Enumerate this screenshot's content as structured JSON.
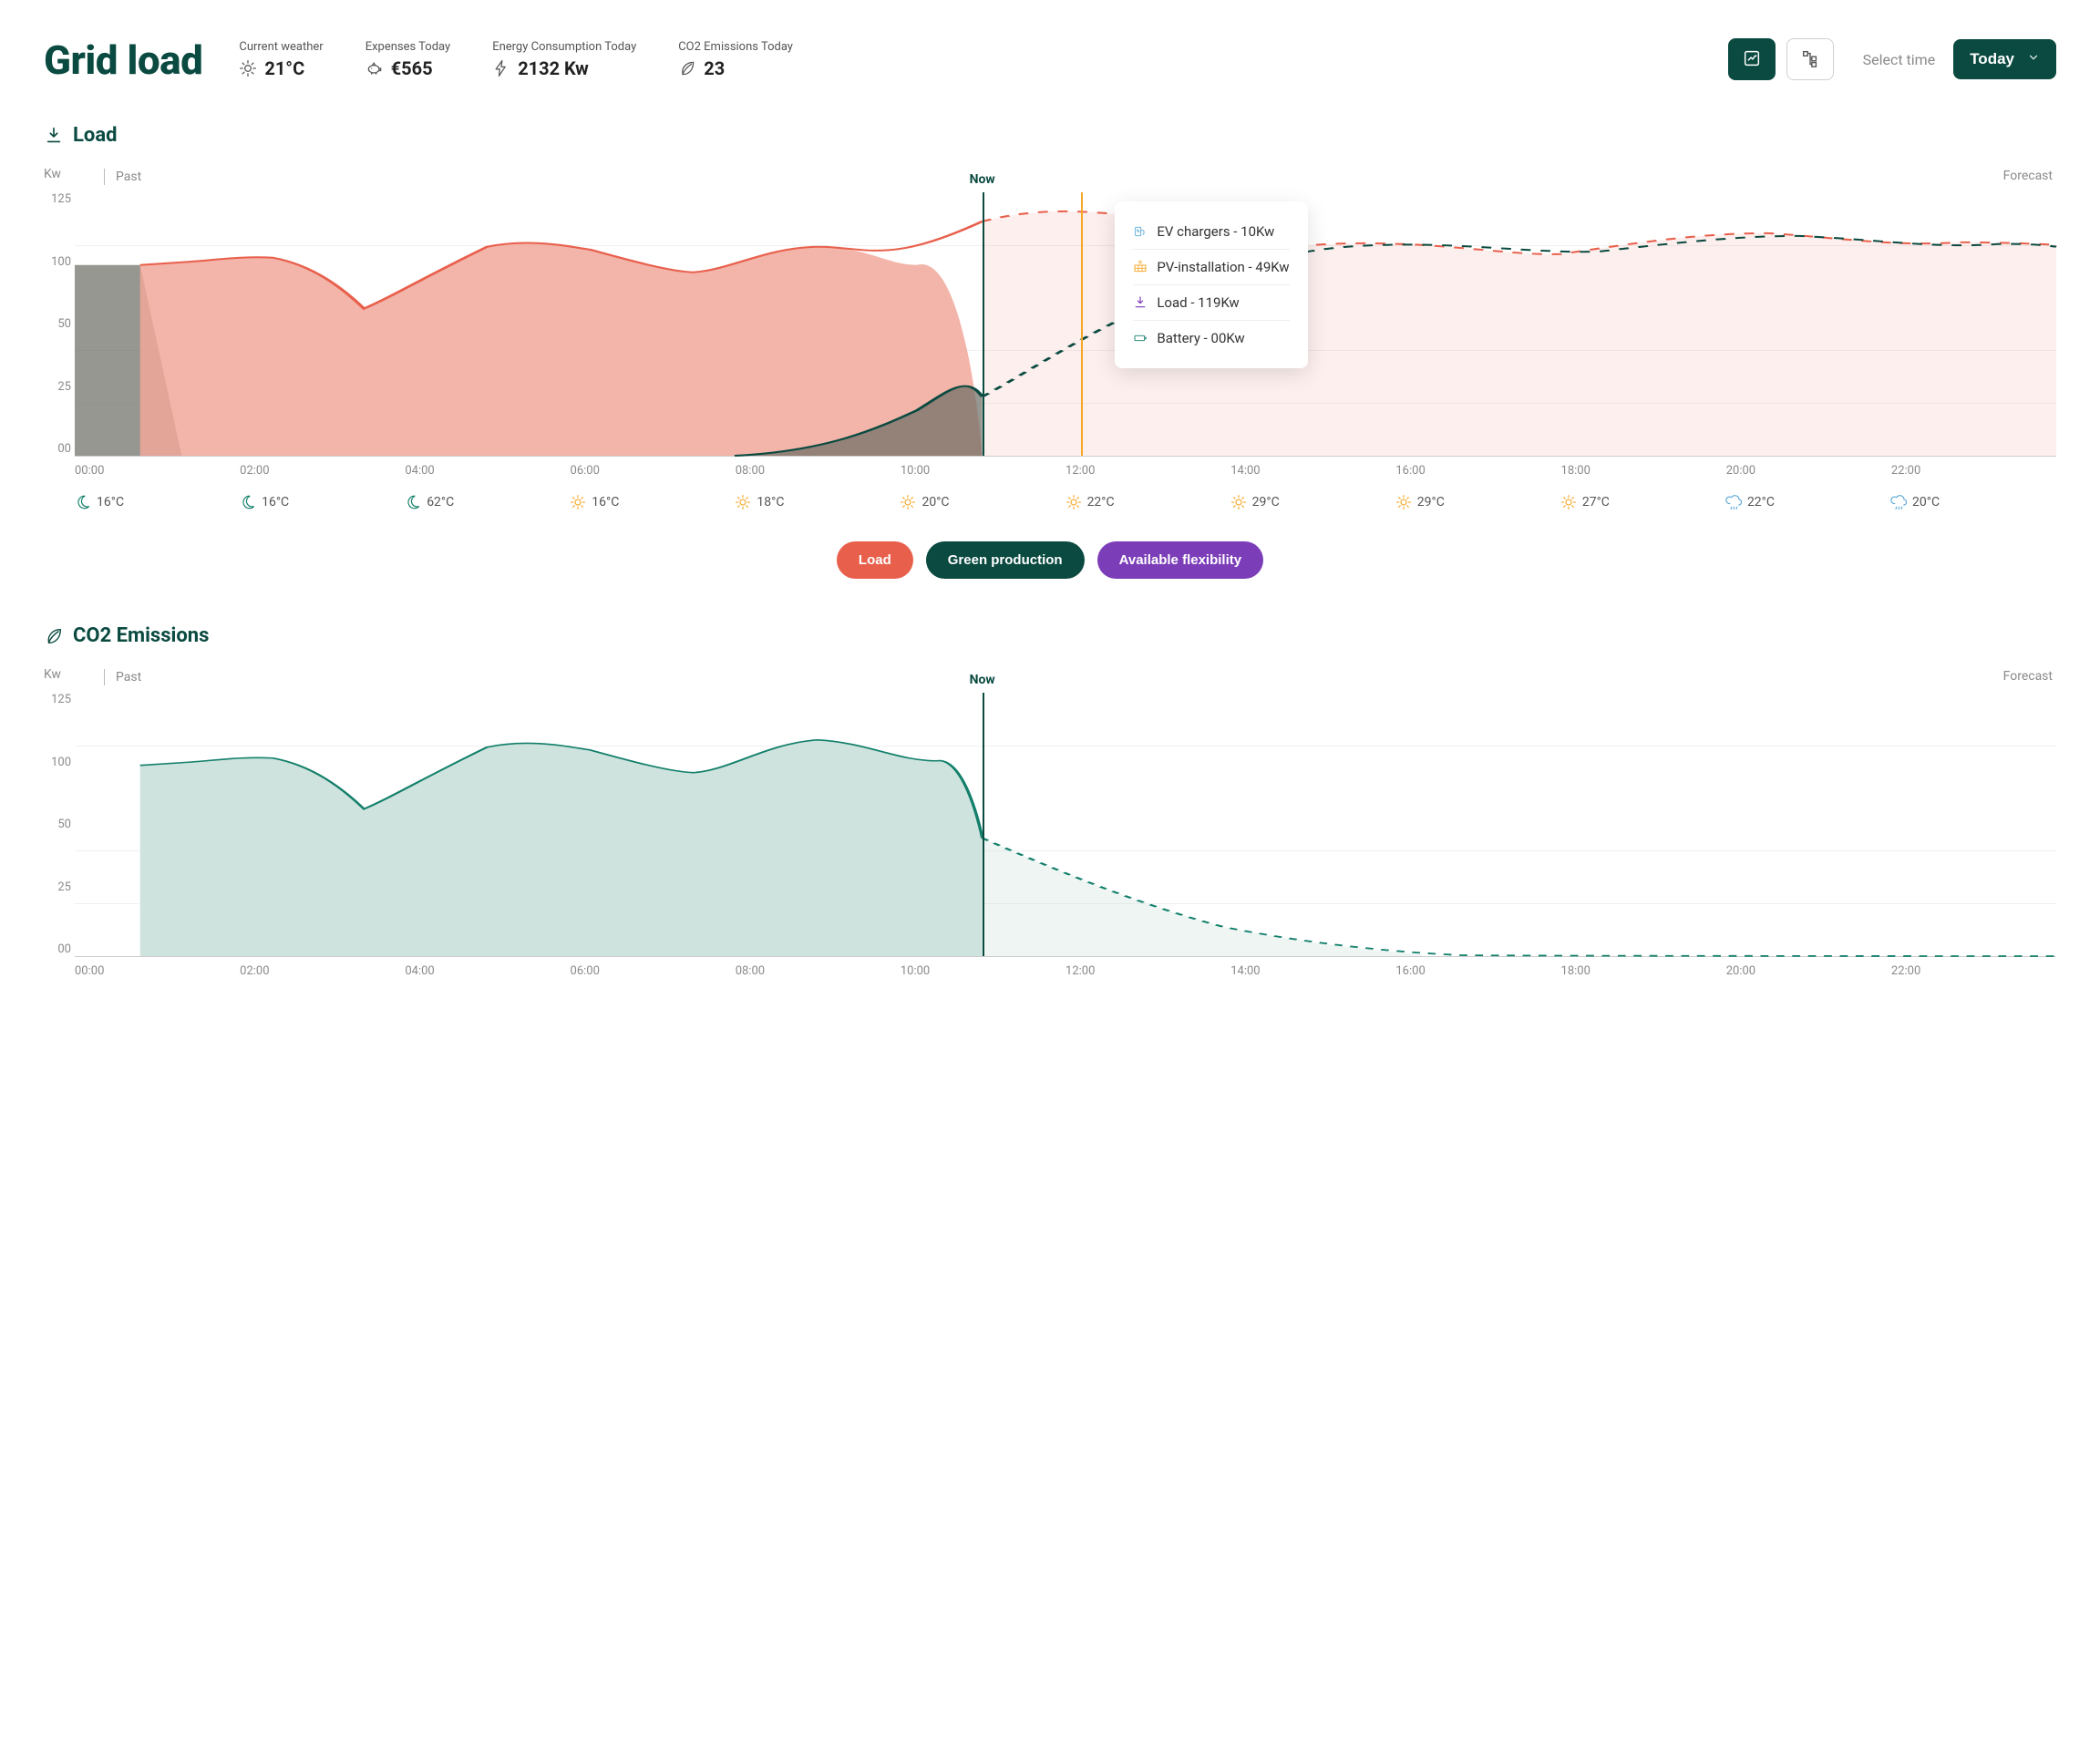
{
  "header": {
    "title": "Grid load",
    "stats": {
      "weather": {
        "label": "Current weather",
        "value": "21°C"
      },
      "expenses": {
        "label": "Expenses Today",
        "value": "€565"
      },
      "energy": {
        "label": "Energy Consumption Today",
        "value": "2132 Kw"
      },
      "co2": {
        "label": "CO2 Emissions Today",
        "value": "23"
      }
    },
    "select_time_label": "Select time",
    "today_label": "Today"
  },
  "sections": {
    "load": {
      "title": "Load"
    },
    "co2": {
      "title": "CO2 Emissions"
    }
  },
  "axis": {
    "y_unit": "Kw",
    "past_label": "Past",
    "now_label": "Now",
    "forecast_label": "Forecast",
    "y_ticks": [
      "125",
      "100",
      "50",
      "25",
      "00"
    ],
    "x_ticks": [
      "00:00",
      "02:00",
      "04:00",
      "06:00",
      "08:00",
      "10:00",
      "12:00",
      "14:00",
      "16:00",
      "18:00",
      "20:00",
      "22:00"
    ]
  },
  "tooltip": {
    "ev": {
      "label": "EV chargers - 10Kw"
    },
    "pv": {
      "label": "PV-installation - 49Kw"
    },
    "load": {
      "label": "Load - 119Kw"
    },
    "bat": {
      "label": "Battery - 00Kw"
    }
  },
  "weather_row": [
    {
      "icon": "moon",
      "temp": "16°C"
    },
    {
      "icon": "moon",
      "temp": "16°C"
    },
    {
      "icon": "moon",
      "temp": "62°C"
    },
    {
      "icon": "sun",
      "temp": "16°C"
    },
    {
      "icon": "sun",
      "temp": "18°C"
    },
    {
      "icon": "sun",
      "temp": "20°C"
    },
    {
      "icon": "sun",
      "temp": "22°C"
    },
    {
      "icon": "sun",
      "temp": "29°C"
    },
    {
      "icon": "sun",
      "temp": "29°C"
    },
    {
      "icon": "sun",
      "temp": "27°C"
    },
    {
      "icon": "rain",
      "temp": "22°C"
    },
    {
      "icon": "rain",
      "temp": "20°C"
    }
  ],
  "pills": {
    "load": "Load",
    "green": "Green production",
    "flex": "Available flexibility"
  },
  "chart_data": [
    {
      "id": "load_chart",
      "type": "area",
      "xlabel": "",
      "ylabel": "Kw",
      "ylim": [
        0,
        125
      ],
      "x": [
        0,
        2,
        4,
        6,
        8,
        10,
        11,
        12,
        14,
        16,
        18,
        20,
        22,
        24
      ],
      "now_x": 11,
      "marker_x": 12.2,
      "series": [
        {
          "name": "Load (past, red area)",
          "color": "#e8604c",
          "values_past": {
            "x": [
              0,
              0.8,
              1.3,
              2,
              3,
              3.5,
              4.5,
              5.5,
              6,
              7,
              7.5,
              8.2,
              9,
              10,
              11
            ],
            "y": [
              0,
              92,
              90,
              95,
              80,
              70,
              85,
              100,
              98,
              88,
              87,
              100,
              102,
              100,
              112
            ]
          }
        },
        {
          "name": "Load forecast (dashed red)",
          "color": "#e8604c",
          "style": "dashed",
          "values_fore": {
            "x": [
              11,
              12.2,
              13,
              14.5,
              16,
              18,
              19.5,
              21,
              22,
              24
            ],
            "y": [
              112,
              118,
              116,
              98,
              103,
              97,
              102,
              105,
              100,
              100
            ]
          }
        },
        {
          "name": "Dark area / green dashed curve",
          "color": "#0a4a40",
          "values_past": {
            "x": [
              0,
              0.8,
              1.3
            ],
            "y": [
              90,
              90,
              0
            ]
          },
          "values_rise": {
            "x": [
              8,
              9.5,
              10.2,
              11,
              12,
              13,
              14,
              15,
              24
            ],
            "y": [
              0,
              5,
              20,
              28,
              50,
              65,
              95,
              100,
              100
            ]
          },
          "style_forecast": "dashed"
        }
      ],
      "tooltip_values": {
        "EV chargers": "10Kw",
        "PV-installation": "49Kw",
        "Load": "119Kw",
        "Battery": "00Kw"
      }
    },
    {
      "id": "co2_chart",
      "type": "area",
      "xlabel": "",
      "ylabel": "Kw",
      "ylim": [
        0,
        125
      ],
      "x": [
        0,
        2,
        4,
        6,
        8,
        10,
        11,
        12,
        14,
        16,
        18,
        20,
        22,
        24
      ],
      "now_x": 11,
      "series": [
        {
          "name": "CO2 (past, mint area)",
          "color": "#cfe3de",
          "values_past": {
            "x": [
              0,
              0.8,
              1.3,
              2,
              3,
              3.5,
              4.5,
              5.5,
              6,
              7,
              7.5,
              8.2,
              9,
              10,
              11
            ],
            "y": [
              0,
              92,
              90,
              95,
              80,
              70,
              85,
              100,
              98,
              88,
              87,
              100,
              102,
              100,
              65
            ]
          }
        },
        {
          "name": "CO2 forecast (dashed teal)",
          "color": "#13806b",
          "style": "dashed",
          "values_fore": {
            "x": [
              11,
              12,
              13,
              14,
              15,
              16,
              18,
              24
            ],
            "y": [
              65,
              42,
              25,
              12,
              5,
              2,
              0,
              0
            ]
          }
        }
      ]
    }
  ]
}
